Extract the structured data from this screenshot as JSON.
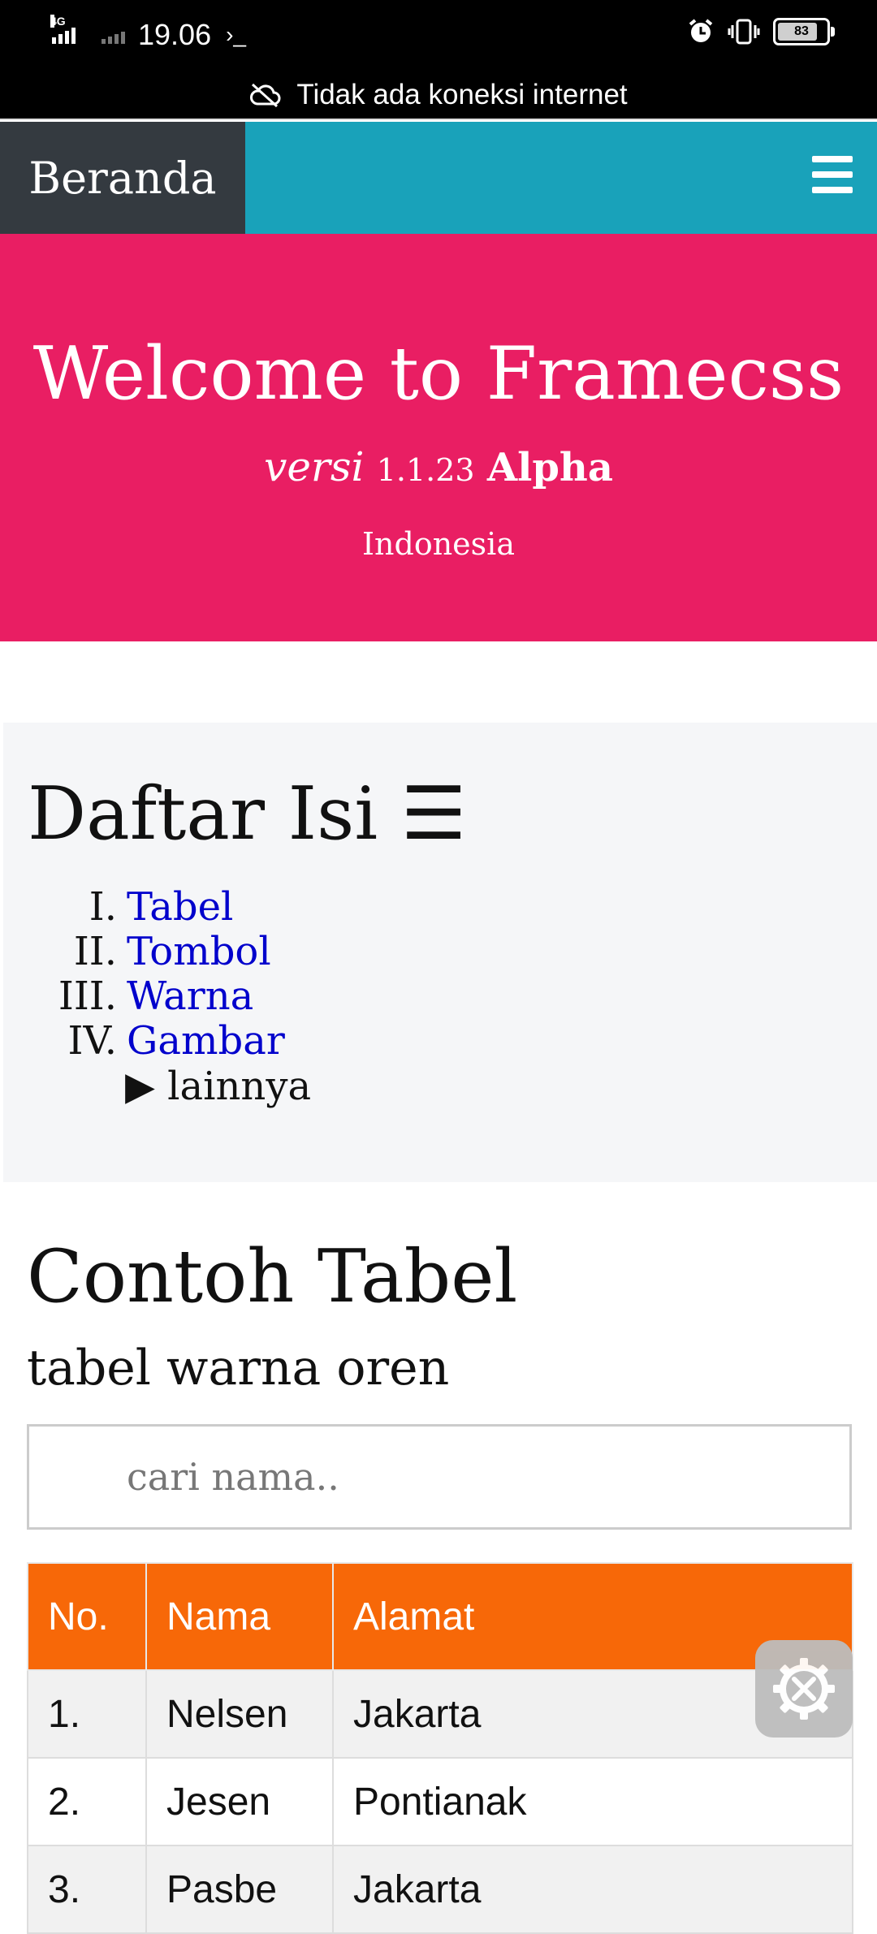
{
  "status_bar": {
    "network": "4G",
    "time": "19.06",
    "terminal": "›_",
    "battery": "83"
  },
  "offline_banner": "Tidak ada koneksi internet",
  "navbar": {
    "brand": "Beranda",
    "menu_icon": "hamburger-icon"
  },
  "hero": {
    "title": "Welcome to Framecss",
    "version_prefix": "versi",
    "version_number": "1.1.23",
    "version_tag": "Alpha",
    "country": "Indonesia"
  },
  "toc": {
    "title": "Daftar Isi ☰",
    "items": [
      {
        "num": "I.",
        "label": "Tabel"
      },
      {
        "num": "II.",
        "label": "Tombol"
      },
      {
        "num": "III.",
        "label": "Warna"
      },
      {
        "num": "IV.",
        "label": "Gambar"
      }
    ],
    "more": "▶ lainnya"
  },
  "table_section": {
    "title": "Contoh Tabel",
    "subtitle": "tabel warna oren",
    "search_placeholder": "cari nama..",
    "headers": [
      "No.",
      "Nama",
      "Alamat"
    ],
    "rows": [
      [
        "1.",
        "Nelsen",
        "Jakarta"
      ],
      [
        "2.",
        "Jesen",
        "Pontianak"
      ],
      [
        "3.",
        "Pasbe",
        "Jakarta"
      ]
    ]
  },
  "colors": {
    "navbar": "#19a2ba",
    "brand_bg": "#343a40",
    "hero": "#e91e63",
    "table_header": "#f76808"
  },
  "fab_icon": "tools-gear-icon"
}
